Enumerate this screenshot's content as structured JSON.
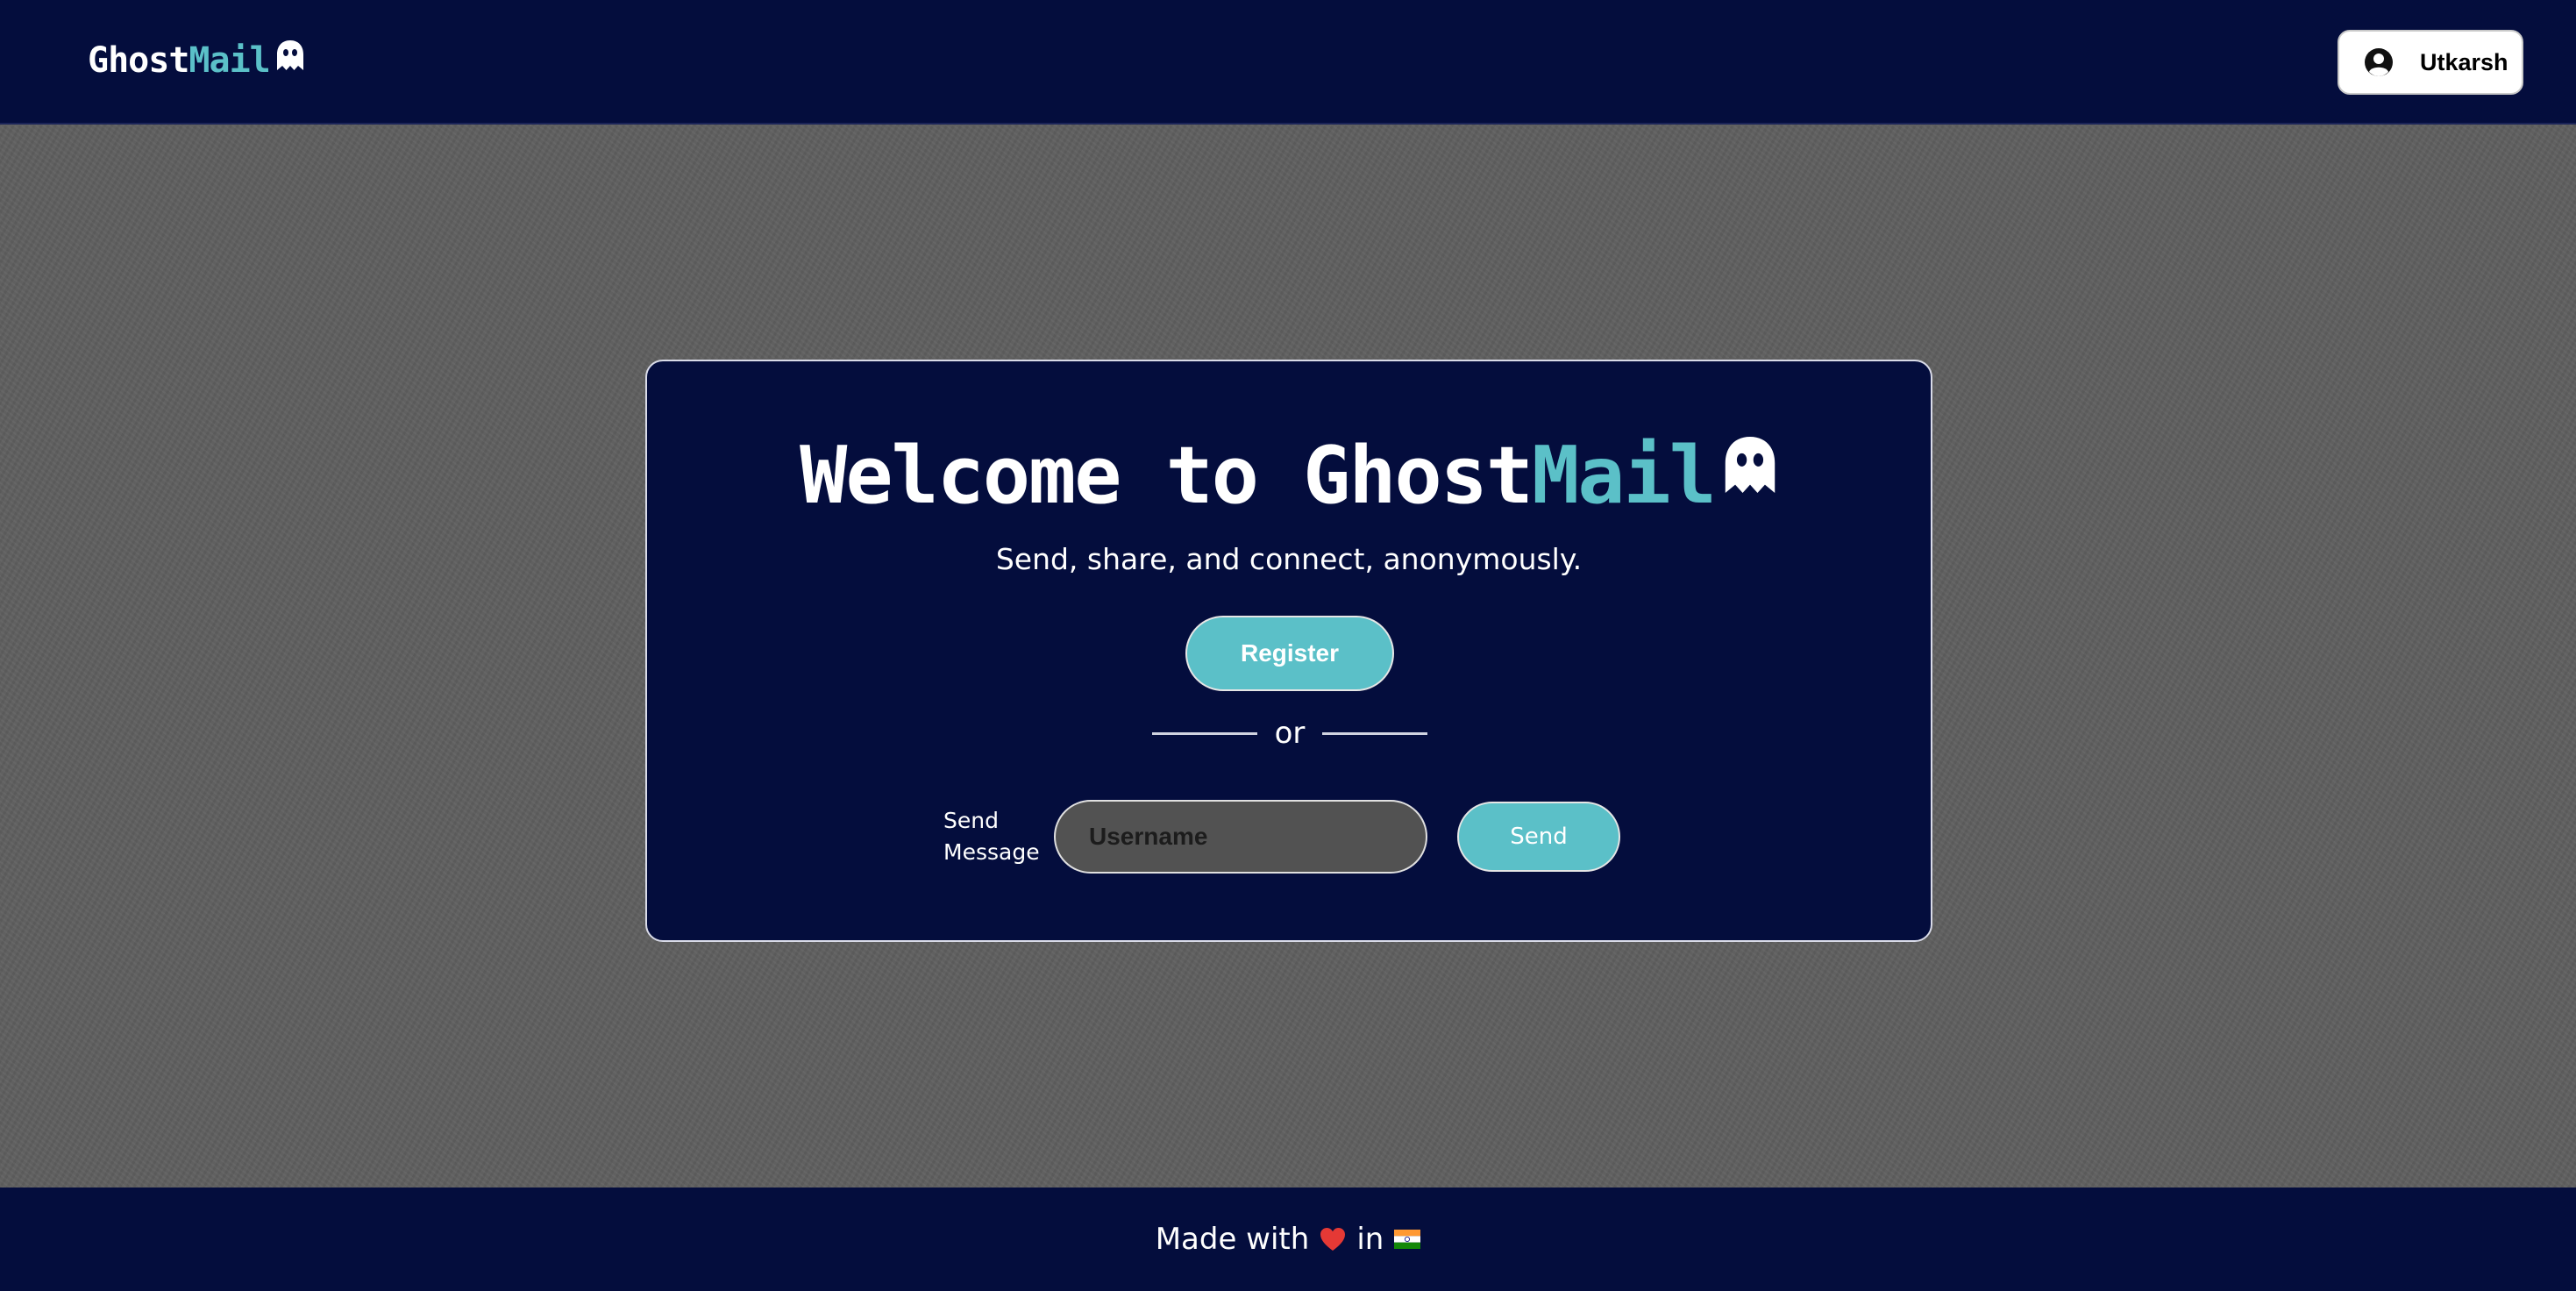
{
  "navbar": {
    "logo_primary": "Ghost",
    "logo_accent": "Mail",
    "logo_icon": "ghost-icon",
    "user_icon": "user-circle-icon",
    "user_name": "Utkarsh"
  },
  "hero": {
    "title_primary": "Welcome to Ghost",
    "title_accent": "Mail",
    "title_icon": "ghost-icon",
    "subtitle": "Send, share, and connect, anonymously.",
    "register_label": "Register",
    "divider_text": "or",
    "send_message_label": "Send Message",
    "username_placeholder": "Username",
    "username_value": "",
    "send_label": "Send"
  },
  "footer": {
    "text_before": "Made with",
    "heart_icon": "heart-icon",
    "text_middle": "in",
    "flag_icon": "india-flag-icon"
  },
  "colors": {
    "navy": "#040d3d",
    "accent": "#5bc0c8",
    "background": "#5f5f5f",
    "input_bg": "#525252"
  }
}
